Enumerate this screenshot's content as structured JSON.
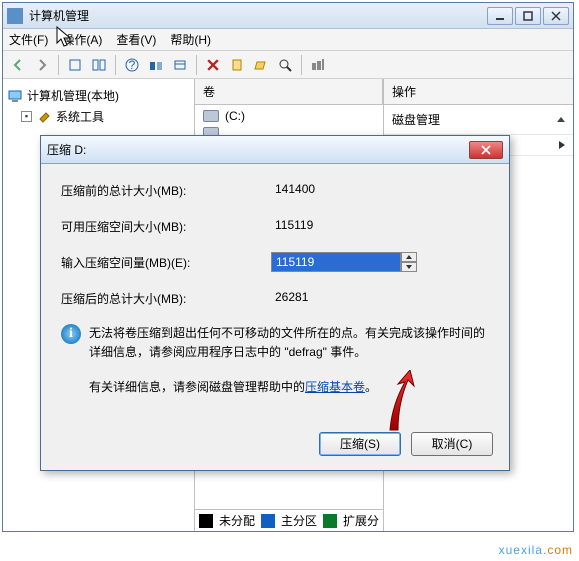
{
  "window": {
    "title": "计算机管理",
    "menu": {
      "file": "文件(F)",
      "action": "操作(A)",
      "view": "查看(V)",
      "help": "帮助(H)"
    },
    "tree": {
      "root": "计算机管理(本地)",
      "sys_tools": "系统工具"
    },
    "vol_header": "卷",
    "vol_c": "(C:)",
    "actions_header": "操作",
    "disk_mgmt": "磁盘管理",
    "legend": {
      "unalloc": "未分配",
      "primary": "主分区",
      "ext": "扩展分"
    }
  },
  "dialog": {
    "title": "压缩 D:",
    "row1_label": "压缩前的总计大小(MB):",
    "row1_value": "141400",
    "row2_label": "可用压缩空间大小(MB):",
    "row2_value": "115119",
    "row3_label": "输入压缩空间量(MB)(E):",
    "row3_value": "115119",
    "row4_label": "压缩后的总计大小(MB):",
    "row4_value": "26281",
    "info1": "无法将卷压缩到超出任何不可移动的文件所在的点。有关完成该操作时间的详细信息，请参阅应用程序日志中的 \"defrag\" 事件。",
    "info2_prefix": "有关详细信息，请参阅磁盘管理帮助中的",
    "info2_link": "压缩基本卷",
    "info2_suffix": "。",
    "btn_shrink": "压缩(S)",
    "btn_cancel": "取消(C)"
  },
  "watermark": {
    "a": "xuexila",
    "b": ".com"
  }
}
